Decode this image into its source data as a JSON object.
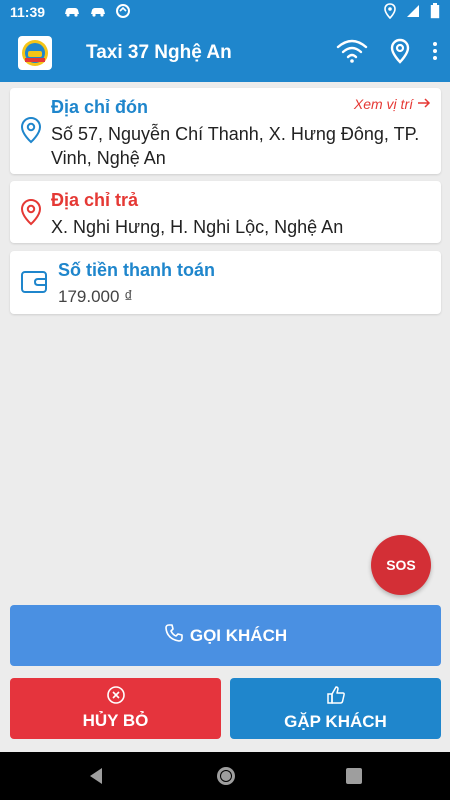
{
  "status_bar": {
    "time": "11:39",
    "left_icons": [
      "car-icon",
      "car-icon",
      "data-saver-icon"
    ],
    "right_icons": [
      "location-icon",
      "signal-icon",
      "battery-icon"
    ]
  },
  "app_bar": {
    "title": "Taxi 37 Nghệ An",
    "actions": [
      "wifi-icon",
      "location-pin-icon",
      "more-vert-icon"
    ]
  },
  "pickup": {
    "label": "Địa chỉ đón",
    "link_label": "Xem vị trí",
    "address": "Số 57, Nguyễn Chí Thanh, X. Hưng Đông, TP. Vinh, Nghệ An"
  },
  "dropoff": {
    "label": "Địa chỉ trả",
    "address": "X. Nghi Hưng, H. Nghi Lộc, Nghệ An"
  },
  "payment": {
    "label": "Số tiền thanh toán",
    "amount": "179.000 ₫"
  },
  "sos": {
    "label": "SOS"
  },
  "buttons": {
    "call": "GỌI KHÁCH",
    "cancel": "HỦY BỎ",
    "meet": "GẶP KHÁCH"
  },
  "colors": {
    "primary": "#1f86cc",
    "call_button": "#4a90e2",
    "danger": "#e5343d",
    "sos": "#d32f36",
    "background": "#ececec"
  }
}
